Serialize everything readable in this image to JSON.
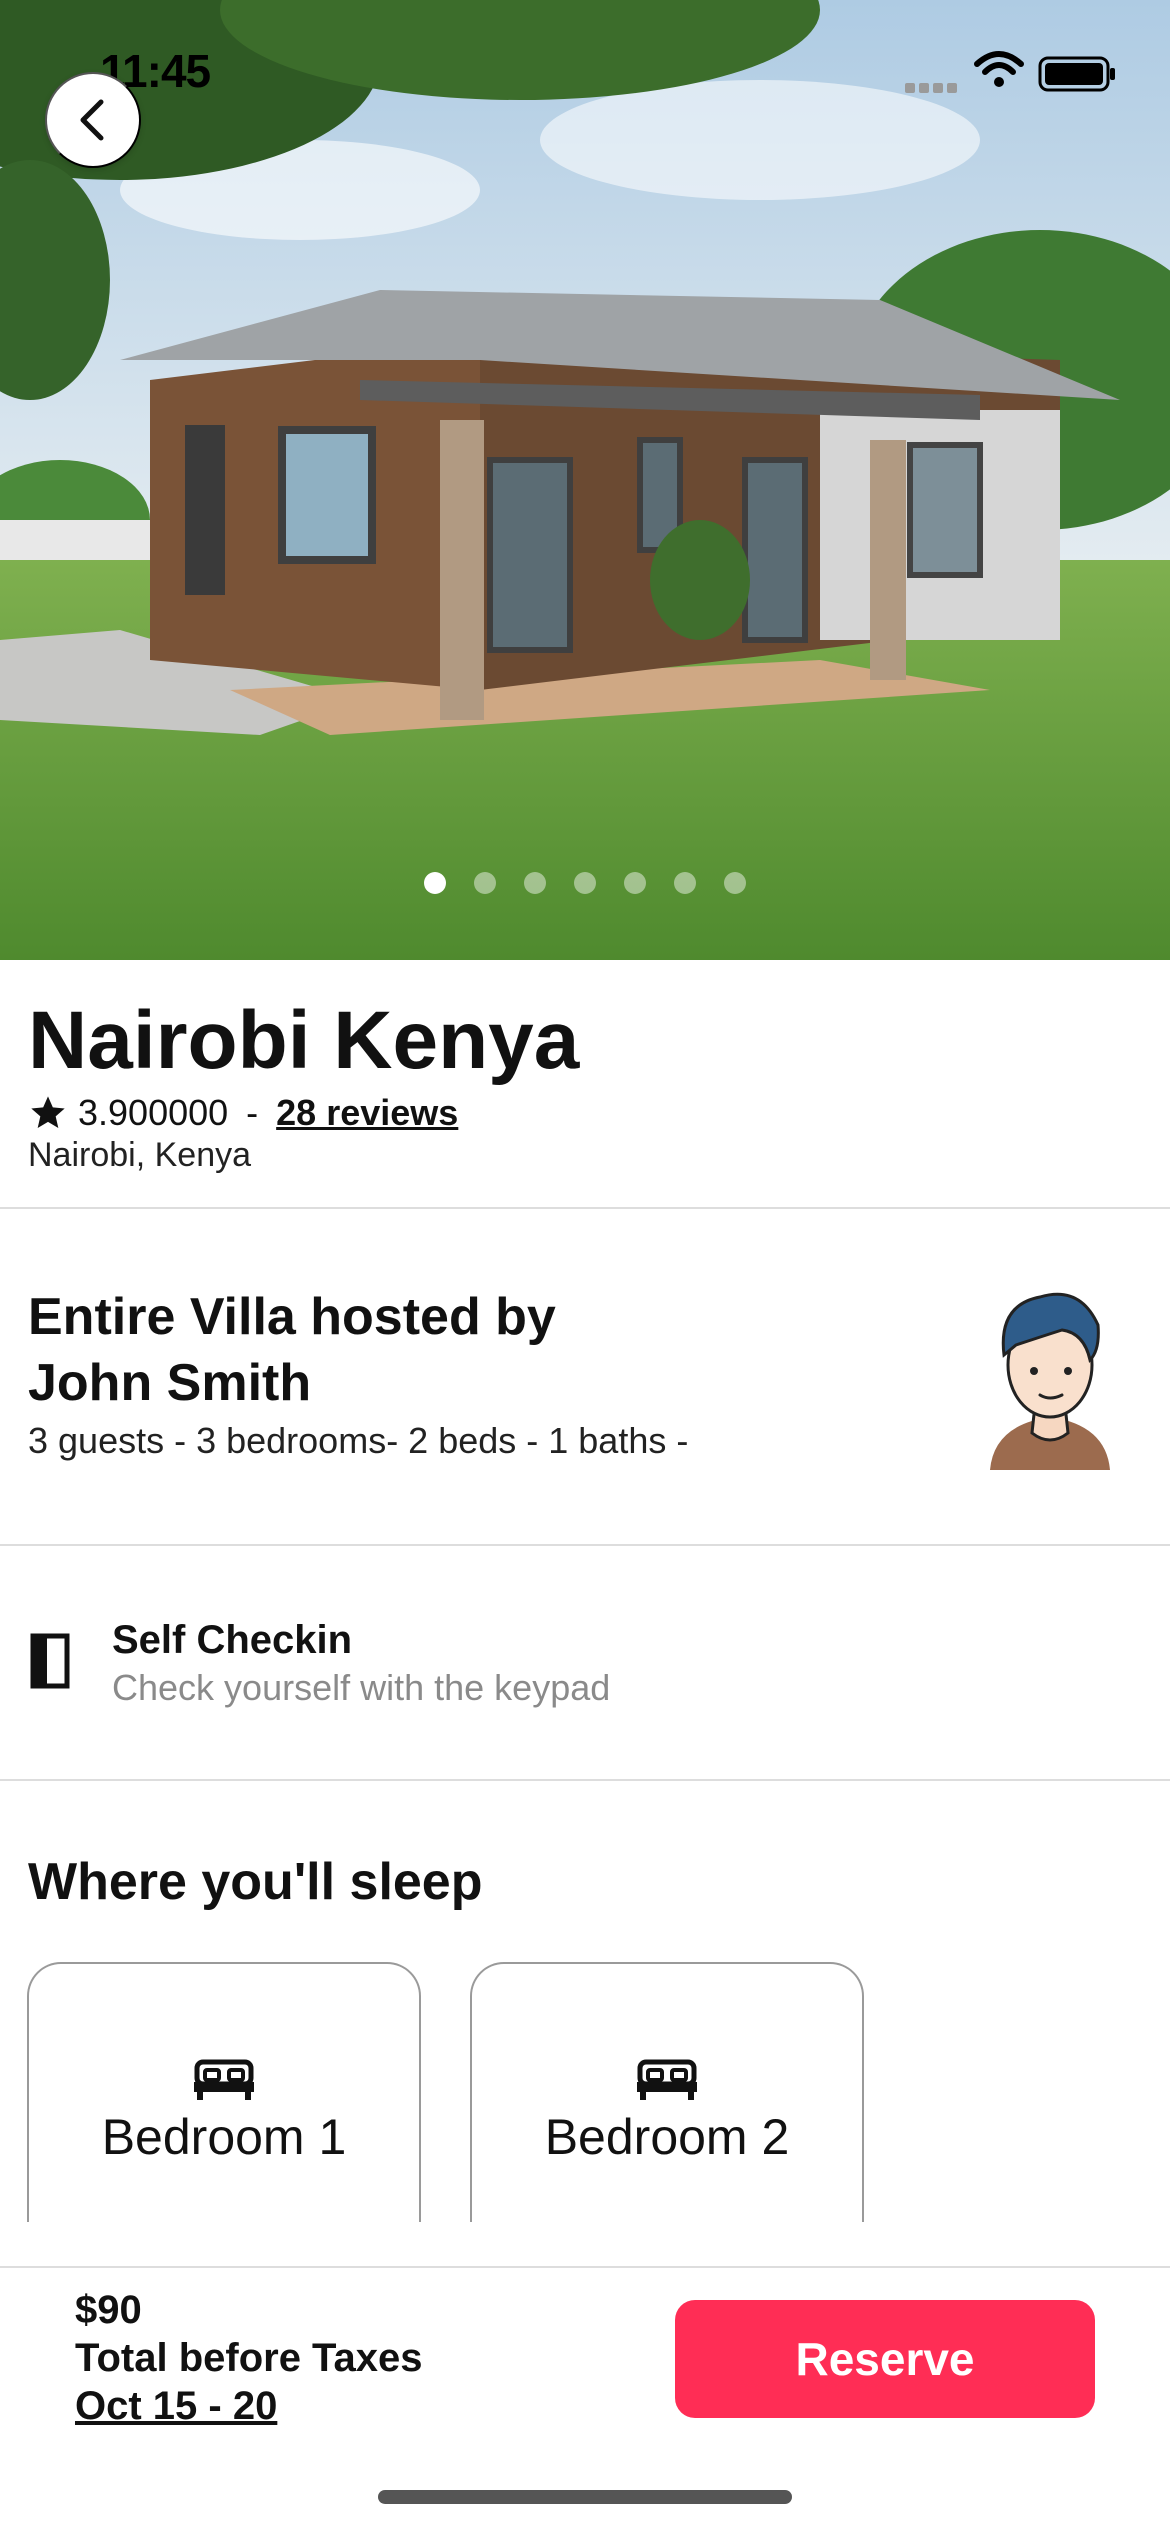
{
  "status_bar": {
    "time": "11:45"
  },
  "gallery": {
    "image_count": 7,
    "active_index": 0
  },
  "listing": {
    "title": "Nairobi Kenya",
    "rating": "3.900000",
    "rating_separator": "-",
    "reviews_link": "28 reviews",
    "location": "Nairobi, Kenya"
  },
  "host": {
    "title": "Entire Villa hosted by John Smith",
    "meta": "3 guests - 3 bedrooms- 2 beds - 1 baths -"
  },
  "checkin": {
    "title": "Self Checkin",
    "subtitle": "Check yourself with the keypad"
  },
  "sleep": {
    "title": "Where you'll sleep",
    "rooms": [
      {
        "label": "Bedroom 1"
      },
      {
        "label": "Bedroom 2"
      }
    ]
  },
  "footer": {
    "price": "$90",
    "price_note": "Total before Taxes",
    "dates": "Oct 15 - 20",
    "reserve_label": "Reserve"
  },
  "colors": {
    "accent": "#ff2d55",
    "divider": "#dddddd",
    "muted_text": "#8a8a8a"
  },
  "icons": [
    "back-chevron",
    "star",
    "door",
    "bed",
    "wifi",
    "battery"
  ]
}
